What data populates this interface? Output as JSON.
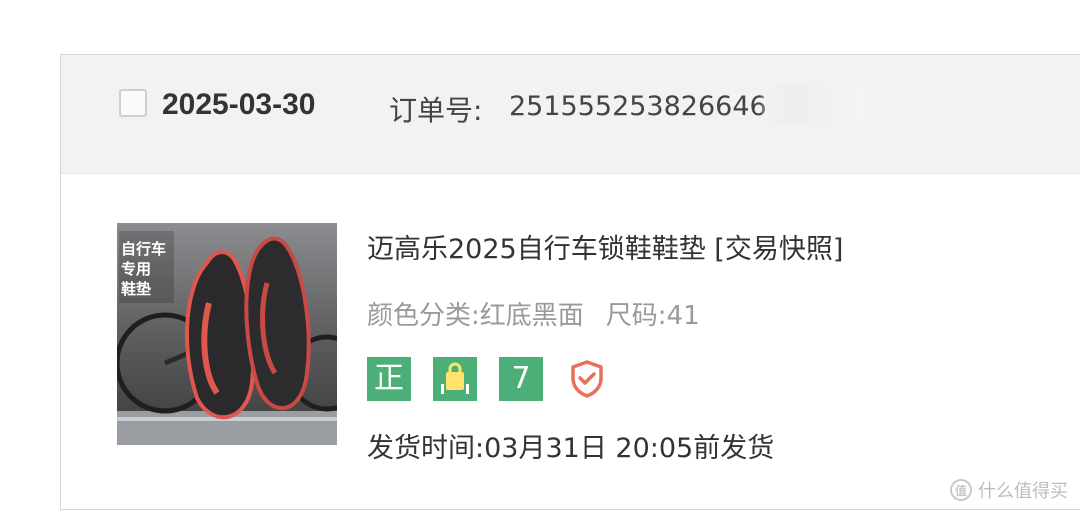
{
  "order": {
    "date": "2025-03-30",
    "order_no_label": "订单号:",
    "order_no_value": "251555253826646",
    "product": {
      "title": "迈高乐2025自行车锁鞋鞋垫 [交易快照]",
      "color_label": "颜色分类:",
      "color_value": "红底黑面",
      "size_label": "尺码:",
      "size_value": "41",
      "thumbnail_text_lines": [
        "自行车",
        "专用",
        "鞋垫"
      ],
      "badges": [
        {
          "icon": "zheng-badge-icon",
          "text": "正",
          "color": "#4caf78"
        },
        {
          "icon": "shopping-bag-badge-icon",
          "color": "#4caf78"
        },
        {
          "icon": "seven-day-return-badge-icon",
          "text": "7",
          "color": "#4caf78"
        },
        {
          "icon": "shield-check-icon",
          "color": "#e8705a"
        }
      ],
      "ship_label": "发货时间:",
      "ship_value": "03月31日 20:05前发货"
    }
  },
  "watermark": {
    "logo_text": "值",
    "text": "什么值得买"
  }
}
